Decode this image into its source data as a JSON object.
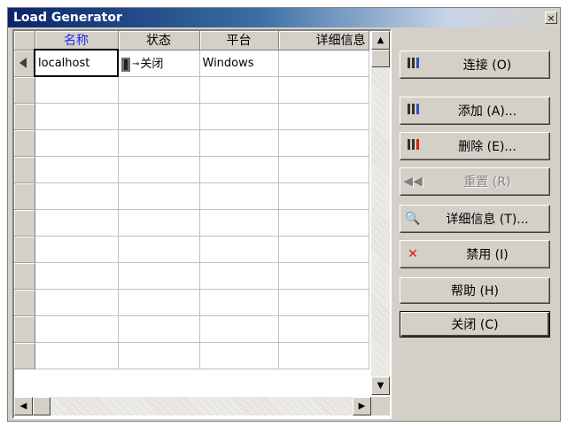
{
  "window": {
    "title": "Load Generator",
    "close_glyph": "×"
  },
  "grid": {
    "columns": [
      "名称",
      "状态",
      "平台",
      "详细信息"
    ],
    "rows": [
      {
        "name": "localhost",
        "status": "关闭",
        "platform": "Windows",
        "details": ""
      }
    ],
    "empty_rows": 11
  },
  "buttons": {
    "connect": {
      "label": "连接 (O)",
      "icon": "connect-icon"
    },
    "add": {
      "label": "添加 (A)...",
      "icon": "add-icon"
    },
    "delete": {
      "label": "删除 (E)...",
      "icon": "delete-icon"
    },
    "reset": {
      "label": "重置 (R)",
      "icon": "rewind-icon",
      "disabled": true
    },
    "details": {
      "label": "详细信息 (T)...",
      "icon": "details-icon"
    },
    "disable": {
      "label": "禁用 (I)",
      "icon": "red-x-icon"
    },
    "help": {
      "label": "帮助 (H)"
    },
    "close": {
      "label": "关闭 (C)"
    }
  },
  "colors": {
    "selected_header": "#1f2cff",
    "title_bar": "#0a246a"
  }
}
